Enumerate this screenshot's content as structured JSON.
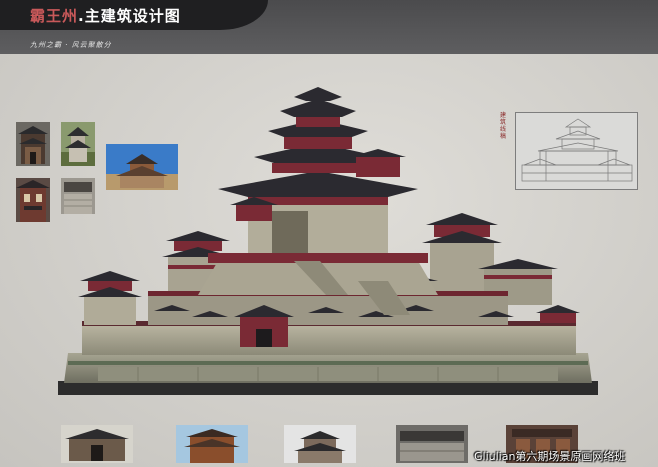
{
  "header": {
    "title_accent": "霸王州",
    "title_rest": ".主建筑设计图",
    "subtitle": "九州之霸 · 风云聚散分"
  },
  "sketch_note": "建筑线稿",
  "watermark": "Gliulian第六期场景原画网络班",
  "colors": {
    "header_dark": "#1f1f21",
    "accent_red": "#c9595a",
    "roof_dark": "#2b2a30",
    "wall_red": "#7a2a35"
  }
}
